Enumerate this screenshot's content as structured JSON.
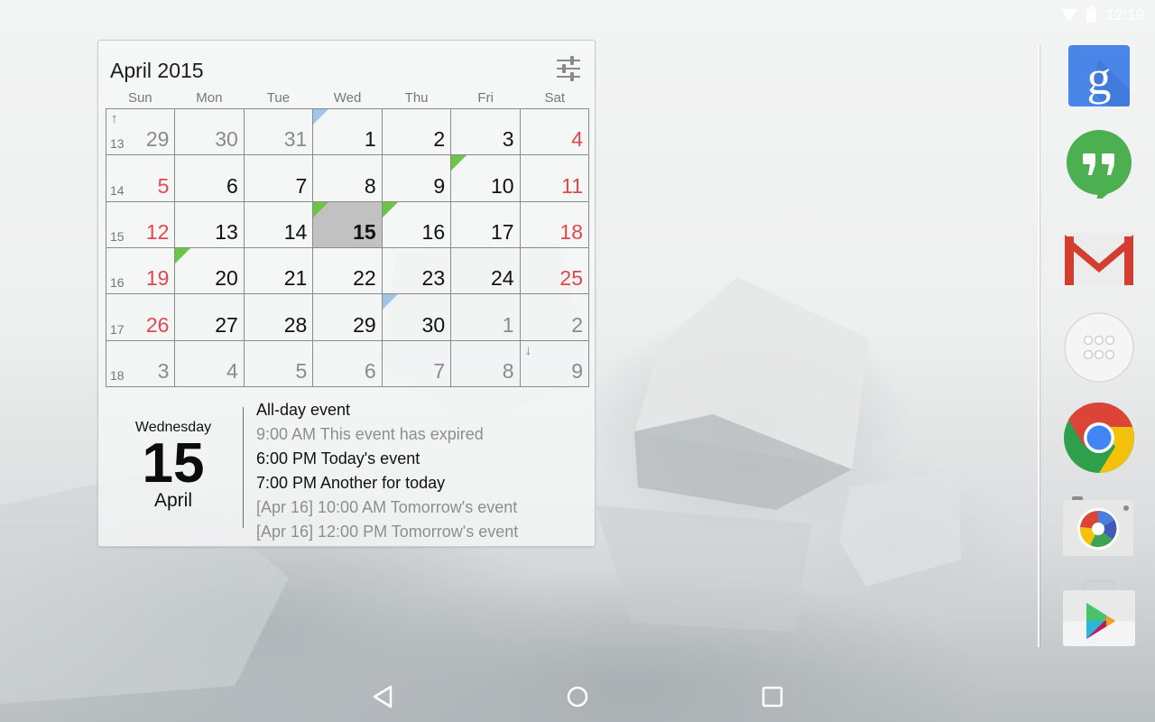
{
  "status_bar": {
    "time": "12:19",
    "icons": [
      "wifi-icon",
      "battery-icon"
    ]
  },
  "widget": {
    "title": "April 2015",
    "settings_icon": "sliders-icon",
    "weekdays": [
      "Sun",
      "Mon",
      "Tue",
      "Wed",
      "Thu",
      "Fri",
      "Sat"
    ],
    "weeks": [
      {
        "week_number": "13",
        "scroll_up": "↑",
        "days": [
          {
            "day": "29",
            "type": "other"
          },
          {
            "day": "30",
            "type": "other"
          },
          {
            "day": "31",
            "type": "other"
          },
          {
            "day": "1",
            "type": "normal",
            "marker": "blue"
          },
          {
            "day": "2",
            "type": "normal"
          },
          {
            "day": "3",
            "type": "normal"
          },
          {
            "day": "4",
            "type": "weekend"
          }
        ]
      },
      {
        "week_number": "14",
        "days": [
          {
            "day": "5",
            "type": "weekend"
          },
          {
            "day": "6",
            "type": "normal"
          },
          {
            "day": "7",
            "type": "normal"
          },
          {
            "day": "8",
            "type": "normal"
          },
          {
            "day": "9",
            "type": "normal"
          },
          {
            "day": "10",
            "type": "normal",
            "marker": "green"
          },
          {
            "day": "11",
            "type": "weekend"
          }
        ]
      },
      {
        "week_number": "15",
        "days": [
          {
            "day": "12",
            "type": "weekend"
          },
          {
            "day": "13",
            "type": "normal"
          },
          {
            "day": "14",
            "type": "normal"
          },
          {
            "day": "15",
            "type": "today",
            "marker": "green"
          },
          {
            "day": "16",
            "type": "normal",
            "marker": "green"
          },
          {
            "day": "17",
            "type": "normal"
          },
          {
            "day": "18",
            "type": "weekend"
          }
        ]
      },
      {
        "week_number": "16",
        "days": [
          {
            "day": "19",
            "type": "weekend"
          },
          {
            "day": "20",
            "type": "normal",
            "marker": "green"
          },
          {
            "day": "21",
            "type": "normal"
          },
          {
            "day": "22",
            "type": "normal"
          },
          {
            "day": "23",
            "type": "normal"
          },
          {
            "day": "24",
            "type": "normal"
          },
          {
            "day": "25",
            "type": "weekend"
          }
        ]
      },
      {
        "week_number": "17",
        "days": [
          {
            "day": "26",
            "type": "weekend"
          },
          {
            "day": "27",
            "type": "normal"
          },
          {
            "day": "28",
            "type": "normal"
          },
          {
            "day": "29",
            "type": "normal"
          },
          {
            "day": "30",
            "type": "normal",
            "marker": "blue"
          },
          {
            "day": "1",
            "type": "other"
          },
          {
            "day": "2",
            "type": "other"
          }
        ]
      },
      {
        "week_number": "18",
        "scroll_down": "↓",
        "days": [
          {
            "day": "3",
            "type": "other"
          },
          {
            "day": "4",
            "type": "other"
          },
          {
            "day": "5",
            "type": "other"
          },
          {
            "day": "6",
            "type": "other"
          },
          {
            "day": "7",
            "type": "other"
          },
          {
            "day": "8",
            "type": "other"
          },
          {
            "day": "9",
            "type": "other"
          }
        ]
      }
    ],
    "selected": {
      "weekday": "Wednesday",
      "day": "15",
      "month": "April"
    },
    "events": [
      {
        "text": "All-day event",
        "past": false
      },
      {
        "text": "9:00 AM This event has expired",
        "past": true
      },
      {
        "text": "6:00 PM Today's event",
        "past": false
      },
      {
        "text": "7:00 PM Another for today",
        "past": false
      },
      {
        "text": "[Apr 16] 10:00 AM Tomorrow's event",
        "past": true
      },
      {
        "text": "[Apr 16] 12:00 PM Tomorrow's event",
        "past": true
      }
    ],
    "colors": {
      "weekend": "#e0474c",
      "marker_green": "#6ec447",
      "marker_blue": "#a2c5e6",
      "today_bg": "#bebebe"
    }
  },
  "dock": {
    "apps": [
      {
        "name": "Google Search",
        "icon": "google-search-icon"
      },
      {
        "name": "Hangouts",
        "icon": "hangouts-icon"
      },
      {
        "name": "Gmail",
        "icon": "gmail-icon"
      },
      {
        "name": "All apps",
        "icon": "app-drawer-icon"
      },
      {
        "name": "Chrome",
        "icon": "chrome-icon"
      },
      {
        "name": "Camera",
        "icon": "camera-icon"
      },
      {
        "name": "Play Store",
        "icon": "play-store-icon"
      }
    ]
  },
  "nav_bar": {
    "buttons": [
      "back-icon",
      "home-icon",
      "recents-icon"
    ]
  }
}
